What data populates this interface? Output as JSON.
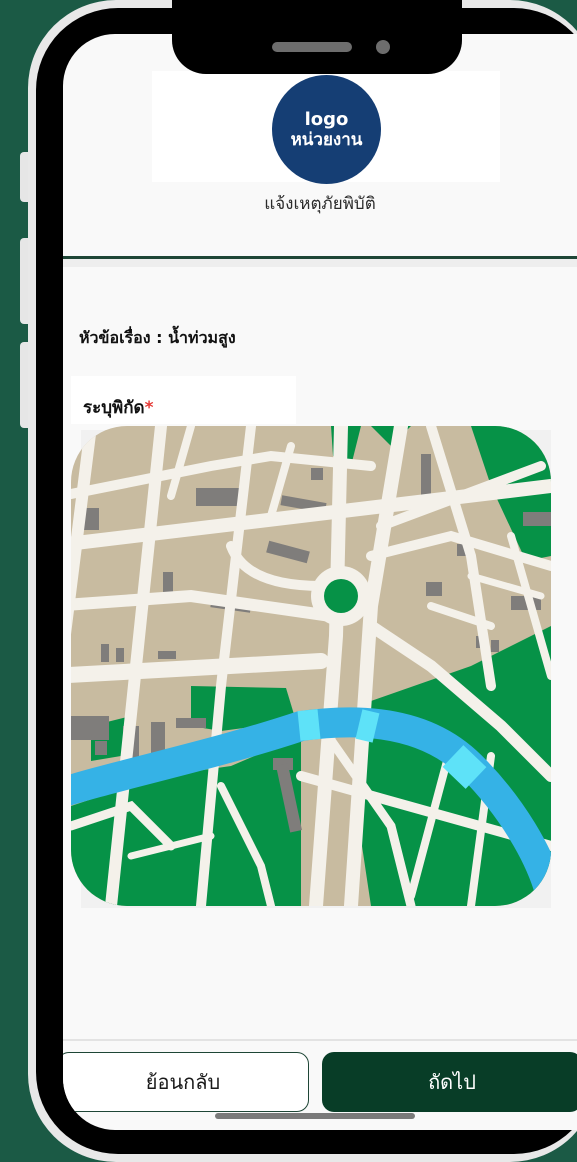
{
  "header": {
    "logo_line1": "logo",
    "logo_line2": "หน่วยงาน",
    "subtitle": "แจ้งเหตุภัยพิบัติ"
  },
  "form": {
    "topic_label": "หัวข้อเรื่อง : น้ำท่วมสูง",
    "location_label": "ระบุพิกัด",
    "required_mark": "*"
  },
  "map": {
    "icon": "city-map-illustration"
  },
  "footer": {
    "back_label": "ย้อนกลับ",
    "next_label": "ถัดไป"
  },
  "colors": {
    "brand_green": "#083d27",
    "logo_blue": "#153e74",
    "required_red": "#e53935",
    "map_land": "#c8bba0",
    "map_park": "#069247",
    "map_water": "#35b2e6",
    "map_road": "#f4f1ea"
  }
}
